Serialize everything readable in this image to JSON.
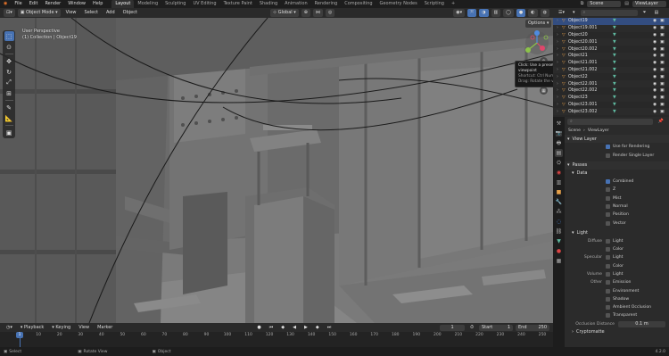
{
  "menu": [
    "File",
    "Edit",
    "Render",
    "Window",
    "Help"
  ],
  "workspaces": [
    "Layout",
    "Modeling",
    "Sculpting",
    "UV Editing",
    "Texture Paint",
    "Shading",
    "Animation",
    "Rendering",
    "Compositing",
    "Geometry Nodes",
    "Scripting"
  ],
  "active_workspace": "Layout",
  "add_workspace": "+",
  "scene_name": "Scene",
  "view_layer": "ViewLayer",
  "viewport_header": {
    "mode": "Object Mode",
    "menus": [
      "View",
      "Select",
      "Add",
      "Object"
    ],
    "transform_orientation": "Global",
    "options": "Options"
  },
  "viewport_overlay": {
    "perspective": "User Perspective",
    "collection": "(1) Collection | Object19"
  },
  "tooltip": {
    "line1": "Click: Use a preset viewpoint",
    "line2": "Shortcut: Ctrl Numpad 1",
    "line3": "Drag: Rotate the view"
  },
  "gizmo_axes": {
    "x": "X",
    "y": "Y",
    "z": "Z"
  },
  "outliner": {
    "search_placeholder": "",
    "rows": [
      "Object19",
      "Object19.001",
      "Object20",
      "Object20.001",
      "Object20.002",
      "Object21",
      "Object21.001",
      "Object21.002",
      "Object22",
      "Object22.001",
      "Object22.002",
      "Object23",
      "Object23.001",
      "Object23.002"
    ]
  },
  "properties": {
    "search_placeholder": "",
    "breadcrumb_scene": "Scene",
    "breadcrumb_layer": "ViewLayer",
    "view_layer_section": "View Layer",
    "use_for_rendering": "Use for Rendering",
    "render_single_layer": "Render Single Layer",
    "passes_section": "Passes",
    "data_section": "Data",
    "data_passes": [
      {
        "label": "Combined",
        "checked": true
      },
      {
        "label": "Z",
        "checked": false
      },
      {
        "label": "Mist",
        "checked": false
      },
      {
        "label": "Normal",
        "checked": false
      },
      {
        "label": "Position",
        "checked": false
      },
      {
        "label": "Vector",
        "checked": false
      }
    ],
    "light_section": "Light",
    "light_groups": [
      {
        "group": "Diffuse",
        "items": [
          "Light",
          "Color"
        ]
      },
      {
        "group": "Specular",
        "items": [
          "Light",
          "Color"
        ]
      },
      {
        "group": "Volume",
        "items": [
          "Light"
        ]
      },
      {
        "group": "Other",
        "items": [
          "Emission",
          "Environment",
          "Shadow",
          "Ambient Occlusion",
          "Transparent"
        ]
      }
    ],
    "occlusion_distance_label": "Occlusion Distance",
    "occlusion_distance_value": "0.1 m",
    "cryptomatte_section": "Cryptomatte"
  },
  "timeline": {
    "playback": "Playback",
    "keying": "Keying",
    "view": "View",
    "marker": "Marker",
    "current_frame": "1",
    "start_label": "Start",
    "start": "1",
    "end_label": "End",
    "end": "250",
    "ticks": [
      "1",
      "10",
      "20",
      "30",
      "40",
      "50",
      "60",
      "70",
      "80",
      "90",
      "100",
      "110",
      "120",
      "130",
      "140",
      "150",
      "160",
      "170",
      "180",
      "190",
      "200",
      "210",
      "220",
      "230",
      "240",
      "250"
    ]
  },
  "statusbar": {
    "select": "Select",
    "rotate": "Rotate View",
    "object": "Object",
    "version": "4.2.0"
  },
  "colors": {
    "accent": "#4772b3",
    "selected_row": "#334d80",
    "object_icon": "#e8a24a",
    "mesh_icon": "#5fb9a0",
    "timeline_playhead": "#4772b3",
    "gizmo_x": "#e0466b",
    "gizmo_y": "#8cc34a",
    "gizmo_z": "#4f8be0"
  }
}
